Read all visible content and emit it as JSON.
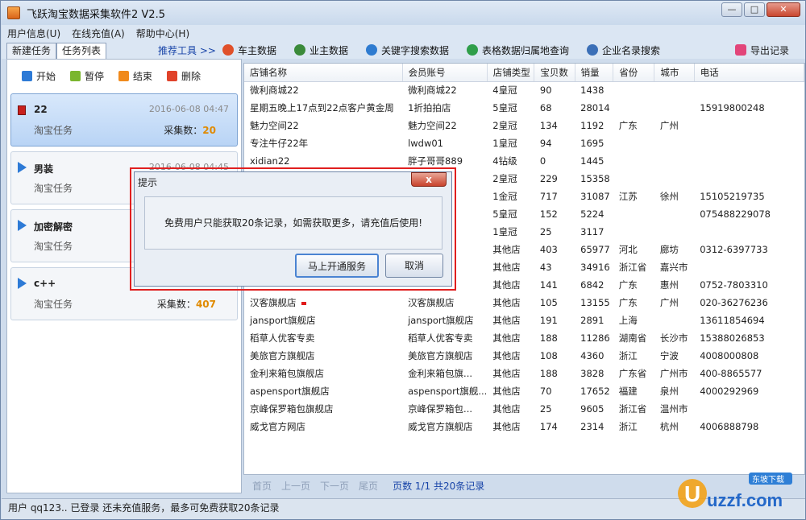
{
  "window": {
    "title": "飞跃淘宝数据采集软件2 V2.5",
    "minimize": "—",
    "maximize": "□",
    "close": "✕"
  },
  "menu": [
    "用户信息(U)",
    "在线充值(A)",
    "帮助中心(H)"
  ],
  "tabs": [
    "新建任务",
    "任务列表"
  ],
  "toolbar": {
    "recommend": "推荐工具 >>",
    "tools": [
      {
        "label": "车主数据",
        "icon": "car-owner-icon",
        "color": "#e0502a"
      },
      {
        "label": "业主数据",
        "icon": "owner-icon",
        "color": "#3a8a3a"
      },
      {
        "label": "关键字搜索数据",
        "icon": "keyword-search-icon",
        "color": "#2e7bd0"
      },
      {
        "label": "表格数据归属地查询",
        "icon": "table-location-icon",
        "color": "#2f9e4a"
      },
      {
        "label": "企业名录搜索",
        "icon": "company-search-icon",
        "color": "#3b6fb7"
      }
    ],
    "export": "导出记录"
  },
  "actions": {
    "start": "开始",
    "pause": "暂停",
    "end": "结束",
    "delete": "删除"
  },
  "tasks": [
    {
      "name": "22",
      "date": "2016-06-08 04:47",
      "type": "淘宝任务",
      "count_label": "采集数：",
      "count": "20",
      "selected": true,
      "icon": "stop"
    },
    {
      "name": "男装",
      "date": "2016-06-08 04:45",
      "type": "淘宝任务",
      "count_label": "",
      "count": "",
      "selected": false,
      "icon": "play"
    },
    {
      "name": "加密解密",
      "date": "",
      "type": "淘宝任务",
      "count_label": "",
      "count": "",
      "selected": false,
      "icon": "play"
    },
    {
      "name": "c++",
      "date": "",
      "type": "淘宝任务",
      "count_label": "采集数：",
      "count": "407",
      "selected": false,
      "icon": "play"
    }
  ],
  "table": {
    "headers": [
      "店铺名称",
      "会员账号",
      "店铺类型",
      "宝贝数",
      "销量",
      "省份",
      "城市",
      "电话"
    ],
    "rows": [
      [
        "微利商城22",
        "微利商城22",
        "4皇冠",
        "90",
        "1438",
        "",
        "",
        ""
      ],
      [
        "星期五晚上17点到22点客户黄金周",
        "1折拍拍店",
        "5皇冠",
        "68",
        "28014",
        "",
        "",
        "15919800248"
      ],
      [
        "魅力空间22",
        "魅力空间22",
        "2皇冠",
        "134",
        "1192",
        "广东",
        "广州",
        ""
      ],
      [
        "专注牛仔22年",
        "lwdw01",
        "1皇冠",
        "94",
        "1695",
        "",
        "",
        ""
      ],
      [
        "xidian22",
        "胖子哥哥889",
        "4钻级",
        "0",
        "1445",
        "",
        "",
        ""
      ],
      [
        "",
        "",
        "2皇冠",
        "229",
        "15358",
        "",
        "",
        ""
      ],
      [
        "",
        "",
        "1金冠",
        "717",
        "31087",
        "江苏",
        "徐州",
        "15105219735"
      ],
      [
        "",
        "",
        "5皇冠",
        "152",
        "5224",
        "",
        "",
        "075488229078"
      ],
      [
        "",
        "o",
        "1皇冠",
        "25",
        "3117",
        "",
        "",
        ""
      ],
      [
        "",
        "舰店",
        "其他店",
        "403",
        "65977",
        "河北",
        "廊坊",
        "0312-6397733"
      ],
      [
        "",
        "专...",
        "其他店",
        "43",
        "34916",
        "浙江省",
        "嘉兴市",
        ""
      ],
      [
        "",
        "",
        "其他店",
        "141",
        "6842",
        "广东",
        "惠州",
        "0752-7803310"
      ],
      [
        "汉客旗舰店",
        "汉客旗舰店",
        "其他店",
        "105",
        "13155",
        "广东",
        "广州",
        "020-36276236"
      ],
      [
        "jansport旗舰店",
        "jansport旗舰店",
        "其他店",
        "191",
        "2891",
        "上海",
        "",
        "13611854694"
      ],
      [
        "稻草人优客专卖",
        "稻草人优客专卖",
        "其他店",
        "188",
        "11286",
        "湖南省",
        "长沙市",
        "15388026853"
      ],
      [
        "美旅官方旗舰店",
        "美旅官方旗舰店",
        "其他店",
        "108",
        "4360",
        "浙江",
        "宁波",
        "4008000808"
      ],
      [
        "金利来箱包旗舰店",
        "金利来箱包旗...",
        "其他店",
        "188",
        "3828",
        "广东省",
        "广州市",
        "400-8865577"
      ],
      [
        "aspensport旗舰店",
        "aspensport旗舰...",
        "其他店",
        "70",
        "17652",
        "福建",
        "泉州",
        "4000292969"
      ],
      [
        "京峰保罗箱包旗舰店",
        "京峰保罗箱包...",
        "其他店",
        "25",
        "9605",
        "浙江省",
        "温州市",
        ""
      ],
      [
        "威戈官方网店",
        "威戈官方旗舰店",
        "其他店",
        "174",
        "2314",
        "浙江",
        "杭州",
        "4006888798"
      ]
    ]
  },
  "pager": {
    "first": "首页",
    "prev": "上一页",
    "next": "下一页",
    "last": "尾页",
    "info": "页数 1/1 共20条记录"
  },
  "status": "用户 qq123.. 已登录 还未充值服务，最多可免费获取20条记录",
  "dialog": {
    "title": "提示",
    "close": "x",
    "message": "免费用户只能获取20条记录，如需获取更多，请充值后使用!",
    "confirm": "马上开通服务",
    "cancel": "取消"
  },
  "watermark": {
    "brand": "uzzf.com",
    "tagline": "东坡下载"
  }
}
